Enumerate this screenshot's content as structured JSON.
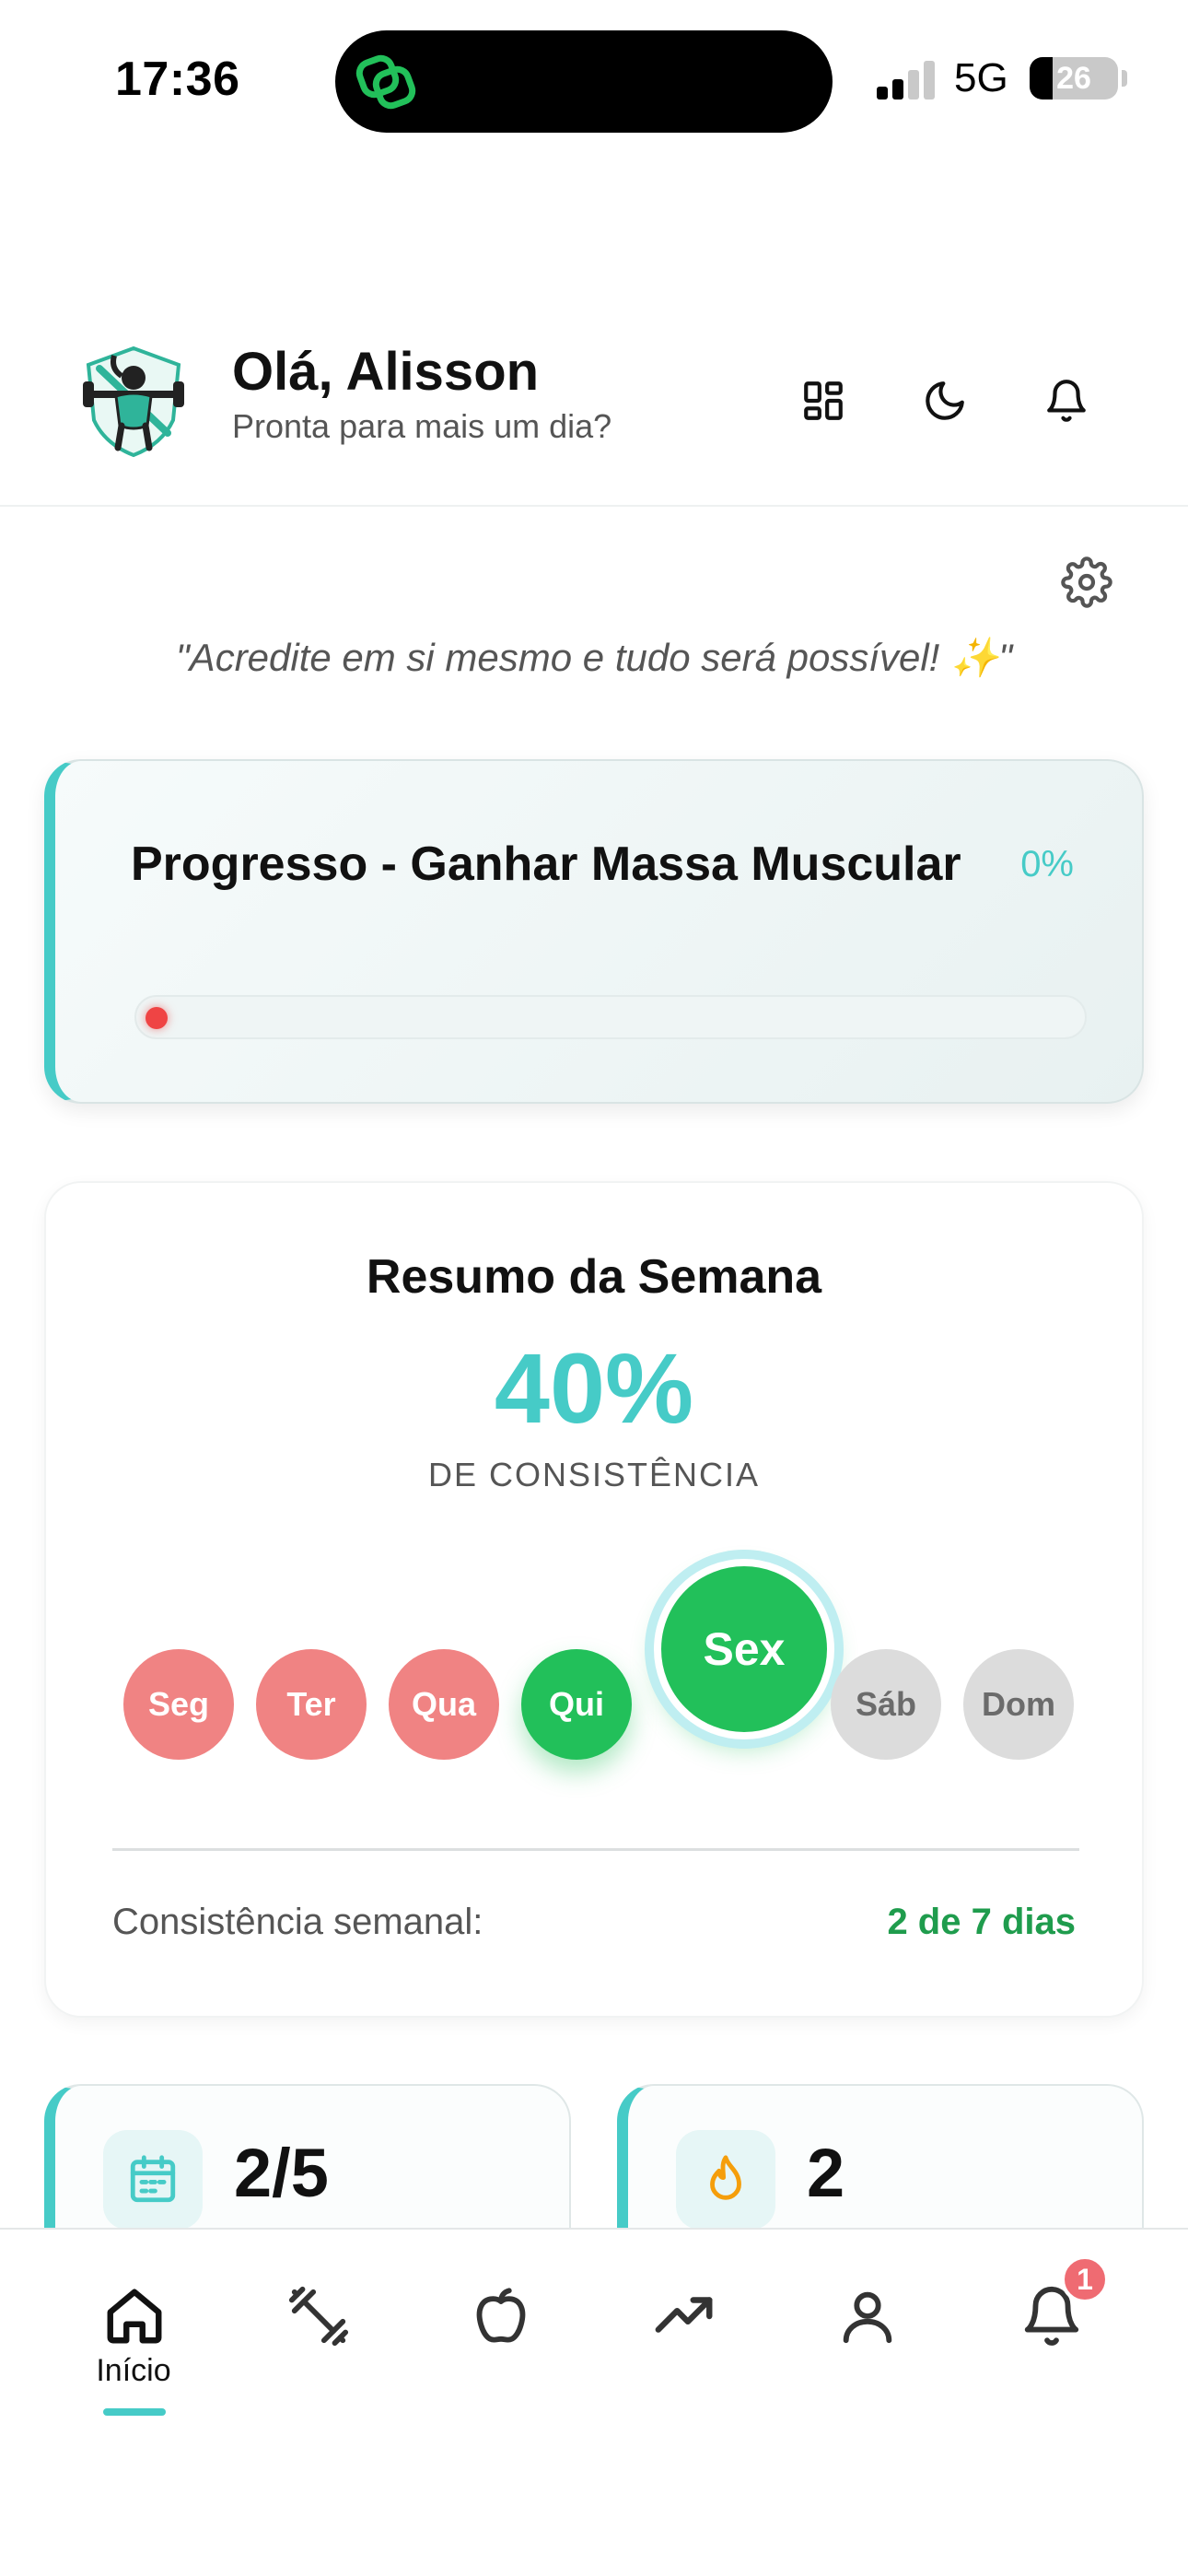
{
  "status_bar": {
    "time": "17:36",
    "network": "5G",
    "battery": "26",
    "icons": [
      "signal-icon",
      "battery-icon",
      "linked-rings-icon"
    ]
  },
  "header": {
    "greeting": "Olá, Alisson",
    "subtitle": "Pronta para mais um dia?",
    "icons": [
      "avatar-fitness-logo",
      "grid-icon",
      "moon-icon",
      "bell-icon"
    ]
  },
  "quote": "\"Acredite em si mesmo e tudo será possível! ✨\"",
  "progress": {
    "title": "Progresso - Ganhar Massa Muscular",
    "percent_label": "0%",
    "value": 0
  },
  "week_summary": {
    "title": "Resumo da Semana",
    "percent": "40%",
    "caption": "DE CONSISTÊNCIA",
    "days": [
      {
        "label": "Seg",
        "status": "missed"
      },
      {
        "label": "Ter",
        "status": "missed"
      },
      {
        "label": "Qua",
        "status": "missed"
      },
      {
        "label": "Qui",
        "status": "done"
      },
      {
        "label": "Sex",
        "status": "today"
      },
      {
        "label": "Sáb",
        "status": "future"
      },
      {
        "label": "Dom",
        "status": "future"
      }
    ],
    "footer_label": "Consistência semanal:",
    "footer_value": "2 de 7 dias"
  },
  "stats": [
    {
      "value": "2/5",
      "icon": "calendar-icon"
    },
    {
      "value": "2",
      "icon": "flame-icon"
    }
  ],
  "tabbar": {
    "tabs": [
      {
        "icon": "home-icon",
        "label": "Início",
        "active": true
      },
      {
        "icon": "dumbbell-icon"
      },
      {
        "icon": "apple-icon"
      },
      {
        "icon": "trending-up-icon"
      },
      {
        "icon": "user-icon"
      },
      {
        "icon": "bell-icon"
      }
    ],
    "badge": "1"
  },
  "colors": {
    "accent": "#46cbc7",
    "success": "#22c05a",
    "missed": "#f08383",
    "future": "#dcdcdc",
    "danger": "#ef4444"
  }
}
